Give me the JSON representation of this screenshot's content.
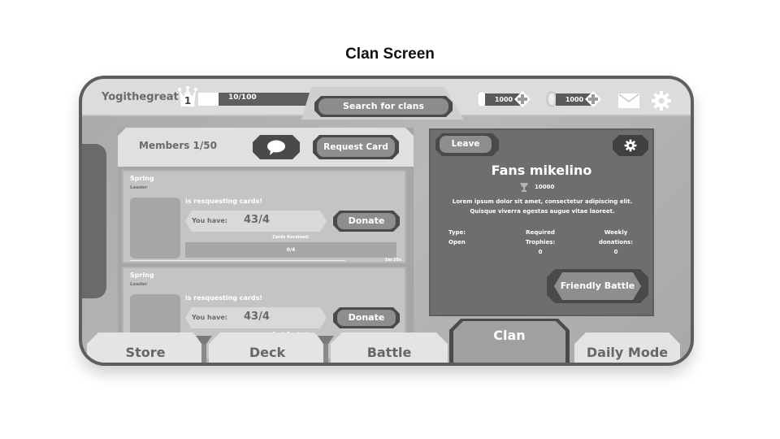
{
  "page": {
    "title": "Clan Screen"
  },
  "header": {
    "username": "Yogithegreat",
    "level": "1",
    "xp_text": "10/100",
    "xp_progress": 0.1,
    "search_button": "Search for clans",
    "currencies": [
      {
        "icon": "gem-icon",
        "amount": "1000"
      },
      {
        "icon": "coin-icon",
        "amount": "1000"
      }
    ],
    "icons": {
      "mail": "mail-icon",
      "settings": "gear-icon"
    }
  },
  "members": {
    "title": "Members 1/50",
    "chat_icon": "chat-bubble-icon",
    "request_button": "Request Card",
    "cards": [
      {
        "name": "Spring",
        "role": "Leader",
        "request_text": "is resquesting cards!",
        "have_label": "You have:",
        "have_value": "43/4",
        "donate_button": "Donate",
        "received_label": "Cards Received:",
        "received_value": "0/4",
        "timer": "1m 20s"
      },
      {
        "name": "Spring",
        "role": "Leader",
        "request_text": "is resquesting cards!",
        "have_label": "You have:",
        "have_value": "43/4",
        "donate_button": "Donate",
        "received_label": "Cards Received:"
      }
    ]
  },
  "clan": {
    "leave_button": "Leave",
    "name": "Fans mikelino",
    "trophies": "10000",
    "description": "Lorem ipsum dolor sit amet, consectetur adipiscing elit. Quisque viverra egestas augue vitae laoreet.",
    "stats": [
      {
        "label": "Type:",
        "value": "Open"
      },
      {
        "label": "Required Trophies:",
        "value": "0"
      },
      {
        "label": "Weekly donations:",
        "value": "0"
      }
    ],
    "friendly_battle_button": "Friendly Battle"
  },
  "nav": {
    "tabs": [
      {
        "label": "Store"
      },
      {
        "label": "Deck"
      },
      {
        "label": "Battle"
      },
      {
        "label": "Clan",
        "active": true
      },
      {
        "label": "Daily Mode"
      }
    ]
  }
}
